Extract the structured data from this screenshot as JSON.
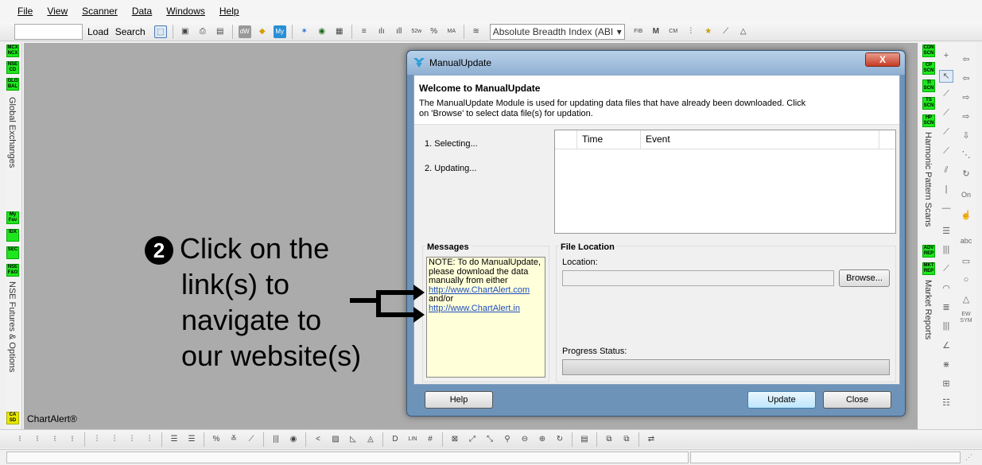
{
  "menubar": {
    "items": [
      "File",
      "View",
      "Scanner",
      "Data",
      "Windows",
      "Help"
    ]
  },
  "toolbar": {
    "load_label": "Load",
    "search_label": "Search",
    "indicator_combo": "Absolute Breadth Index (ABI"
  },
  "left_panel": {
    "top_buttons": [
      "MCX NCX",
      "NSE CD",
      "GLO BAL"
    ],
    "global_label": "Global Exchanges",
    "mid_buttons": [
      "My Fav",
      "IDX",
      "SEC",
      "NSE F&O"
    ],
    "fo_label": "NSE Futures & Options",
    "bottom_button": "CA SD",
    "app_label": "ChartAlert®"
  },
  "right_panel": {
    "scan_buttons": [
      "CDN SCN",
      "CP SCN",
      "TI SCN",
      "TS SCN",
      "HP SCN"
    ],
    "harmonic_label": "Harmonic Pattern Scans",
    "report_buttons": [
      "ADV REP",
      "MKT REP"
    ],
    "market_label": "Market Reports",
    "tool_on": "On",
    "tool_abc": "abc",
    "tool_ew": "EW SYM"
  },
  "dialog": {
    "title": "ManualUpdate",
    "close_label": "X",
    "heading": "Welcome to ManualUpdate",
    "description": "The ManualUpdate Module is used for updating data files that have already been downloaded. Click on 'Browse' to select data file(s) for updation.",
    "steps": [
      "1. Selecting...",
      "2. Updating..."
    ],
    "log_columns": [
      "Time",
      "Event"
    ],
    "messages_label": "Messages",
    "message_text": "NOTE: To do ManualUpdate, please download the data manually from either",
    "link1": "http://www.ChartAlert.com",
    "and_or": "and/or",
    "link2": "http://www.ChartAlert.in",
    "file_location_label": "File Location",
    "location_label": "Location:",
    "location_value": "",
    "browse_label": "Browse...",
    "progress_label": "Progress Status:",
    "progress_value": 0,
    "help_label": "Help",
    "update_label": "Update",
    "close_button_label": "Close"
  },
  "annotation": {
    "number": "2",
    "lines": [
      "Click on the",
      "link(s) to",
      "navigate to",
      "our website(s)"
    ]
  }
}
